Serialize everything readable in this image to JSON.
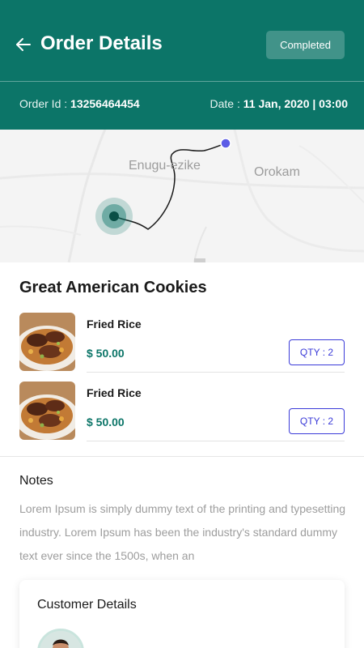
{
  "header": {
    "title": "Order Details",
    "status": "Completed",
    "order_id_label": "Order Id : ",
    "order_id": "13256464454",
    "date_label": "Date : ",
    "date": "11 Jan, 2020 | 03:00"
  },
  "map": {
    "labels": [
      "Enugu-ezike",
      "Orokam"
    ]
  },
  "restaurant": {
    "name": "Great American Cookies"
  },
  "items": [
    {
      "name": "Fried Rice",
      "price": "$ 50.00",
      "qty": "QTY : 2"
    },
    {
      "name": "Fried Rice",
      "price": "$ 50.00",
      "qty": "QTY : 2"
    }
  ],
  "notes": {
    "title": "Notes",
    "text": "Lorem Ipsum is simply dummy text of the printing and typesetting industry. Lorem Ipsum has been the industry's standard dummy text ever since the 1500s, when an"
  },
  "customer": {
    "title": "Customer Details"
  },
  "colors": {
    "primary": "#0c7568",
    "qty_accent": "#3a3ad8",
    "muted_text": "#9d9d9d"
  }
}
